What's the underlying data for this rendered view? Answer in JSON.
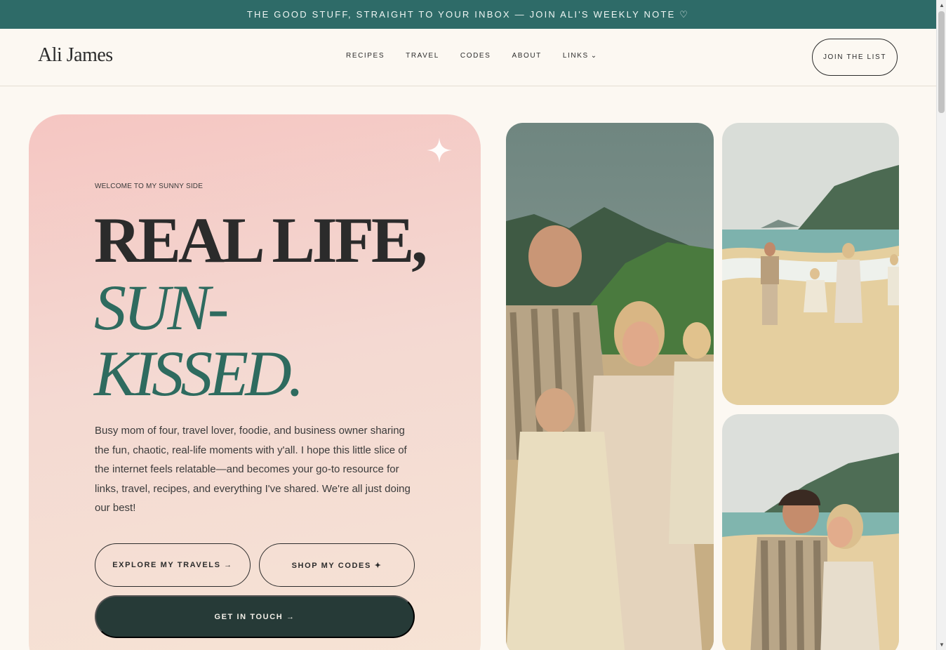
{
  "announcement": {
    "text": "THE GOOD STUFF, STRAIGHT TO YOUR INBOX — JOIN ALI'S WEEKLY NOTE ♡"
  },
  "header": {
    "logo": "Ali James",
    "menu": [
      {
        "label": "RECIPES"
      },
      {
        "label": "TRAVEL"
      },
      {
        "label": "CODES"
      },
      {
        "label": "ABOUT"
      },
      {
        "label": "LINKS",
        "chevron": "⌄"
      }
    ],
    "cta": "JOIN THE LIST"
  },
  "hero": {
    "eyebrow": "WELCOME TO MY SUNNY SIDE",
    "title_line1": "REAL LIFE,",
    "title_line2": "SUN-",
    "title_line3": "KISSED.",
    "description": "Busy mom of four, travel lover, foodie, and business owner sharing the fun, chaotic, real-life moments with y'all. I hope this little slice of the internet feels relatable—and becomes your go-to resource for links, travel, recipes, and everything I've shared. We're all just doing our best!",
    "buttons": {
      "travels": "EXPLORE MY TRAVELS →",
      "codes": "SHOP MY CODES ✦",
      "touch": "GET IN TOUCH →"
    }
  },
  "colors": {
    "announcement_bg": "#2e6b68",
    "accent_green": "#2e6b5f",
    "dark_button": "#263a37",
    "page_bg": "#fcf8f2",
    "hero_pink": "#f5c6c2"
  },
  "icons": {
    "sparkle": "sparkle-icon",
    "chevron": "chevron-down-icon"
  }
}
